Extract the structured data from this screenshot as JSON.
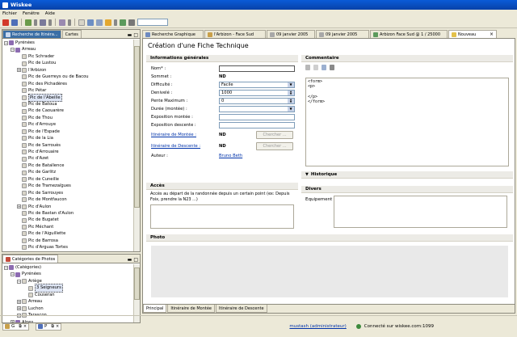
{
  "window": {
    "title": "Wiskee"
  },
  "menu": [
    {
      "label": "Fichier"
    },
    {
      "label": "Fenêtre"
    },
    {
      "label": "Aide"
    }
  ],
  "toolbar": {
    "search_value": ""
  },
  "left_top_tabs": [
    {
      "label": "Recherche de Itinéra..."
    },
    {
      "label": "Cartes"
    }
  ],
  "tree": [
    {
      "label": "Pyrénées",
      "level": 0,
      "exp": "-"
    },
    {
      "label": "Arreau",
      "level": 1,
      "exp": "-"
    },
    {
      "label": "Pic Schrader",
      "level": 2
    },
    {
      "label": "Pic de Lustou",
      "level": 2
    },
    {
      "label": "l'Arbizon",
      "level": 2,
      "exp": "+"
    },
    {
      "label": "Pic de Guerreys ou de Bacou",
      "level": 2
    },
    {
      "label": "Pic des Pichadères",
      "level": 2
    },
    {
      "label": "Pic Pétar",
      "level": 2
    },
    {
      "label": "Pic de l'Abeille",
      "level": 2,
      "selected": true
    },
    {
      "label": "Pic de Batoua",
      "level": 2
    },
    {
      "label": "Pic de Caouarère",
      "level": 2
    },
    {
      "label": "Pic de Thou",
      "level": 2
    },
    {
      "label": "Pic d'Arrouye",
      "level": 2
    },
    {
      "label": "Pic de l'Espade",
      "level": 2
    },
    {
      "label": "Pic de la Lia",
      "level": 2
    },
    {
      "label": "Pic de Sarrouès",
      "level": 2
    },
    {
      "label": "Pic d'Arrouaire",
      "level": 2
    },
    {
      "label": "Pic d'Azet",
      "level": 2
    },
    {
      "label": "Pic de Batallence",
      "level": 2
    },
    {
      "label": "Pic de Garlitz",
      "level": 2
    },
    {
      "label": "Pic de Cuneille",
      "level": 2
    },
    {
      "label": "Pic de Tramezaïgues",
      "level": 2
    },
    {
      "label": "Pic de Sarrouyes",
      "level": 2
    },
    {
      "label": "Pic de Montfaucon",
      "level": 2
    },
    {
      "label": "Pic d'Aulon",
      "level": 2,
      "exp": "+"
    },
    {
      "label": "Pic de Bastan d'Aulon",
      "level": 2
    },
    {
      "label": "Pic de Bugatet",
      "level": 2
    },
    {
      "label": "Pic Méchant",
      "level": 2
    },
    {
      "label": "Pic de l'Aiguillette",
      "level": 2
    },
    {
      "label": "Pic de Barrosa",
      "level": 2
    },
    {
      "label": "Pic d'Arguas Tortes",
      "level": 2
    }
  ],
  "photo_panel": {
    "title": "Catégories de Photos"
  },
  "photo_tree": [
    {
      "label": "(Catégories)",
      "level": 0,
      "exp": "-"
    },
    {
      "label": "Pyrénées",
      "level": 1,
      "exp": "-"
    },
    {
      "label": "Ariège",
      "level": 2,
      "exp": "-"
    },
    {
      "label": "3 Seigneurs",
      "level": 3,
      "selected": true
    },
    {
      "label": "Couseran",
      "level": 3
    },
    {
      "label": "Arreau",
      "level": 2,
      "exp": "+"
    },
    {
      "label": "Luchon",
      "level": 2,
      "exp": "+"
    },
    {
      "label": "Tarascon",
      "level": 2,
      "exp": "+"
    },
    {
      "label": "Alpes",
      "level": 1,
      "exp": "+"
    }
  ],
  "editor_tabs": [
    {
      "label": "Recherche Graphique"
    },
    {
      "label": "l'Arbizon - Face Sud"
    },
    {
      "label": "09 janvier 2005"
    },
    {
      "label": "09 janvier 2005"
    },
    {
      "label": "Arbizon Face Sud @ 1 / 25000"
    },
    {
      "label": "Nouveau",
      "active": true
    }
  ],
  "form": {
    "title": "Création d'une Fiche Technique",
    "general_header": "Informations générales",
    "nom_label": "Nom* :",
    "nom_value": "",
    "sommet_label": "Sommet :",
    "sommet_value": "ND",
    "difficulte_label": "Difficulté :",
    "difficulte_value": "Facile",
    "denivele_label": "Denivelé :",
    "denivele_value": "1000",
    "pente_label": "Pente Maximum :",
    "pente_value": "0",
    "duree_label": "Durée (montée) :",
    "duree_value": "",
    "expo_montee_label": "Exposition montée :",
    "expo_descente_label": "Exposition descente :",
    "iti_montee_label": "Itinéraire de Montée :",
    "iti_montee_value": "ND",
    "iti_descente_label": "Itinéraire de Descente :",
    "iti_descente_value": "ND",
    "chercher_label": "Chercher ...",
    "auteur_label": "Auteur :",
    "auteur_value": "Bruno Beth",
    "acces_header": "Accès",
    "acces_desc": "Accès au départ de la randonnée depuis un certain point (ex: Depuis Foix, prendre la N23 ...)",
    "commentaire_header": "Commentaire",
    "comment_text": "<form>\n<p>\n\n</p>\n</form>",
    "historique_header": "Historique",
    "divers_header": "Divers",
    "equipement_label": "Equipement",
    "photo_header": "Photo"
  },
  "bottom_tabs": [
    {
      "label": "Principal",
      "active": true
    },
    {
      "label": "Itinéraire de Montée"
    },
    {
      "label": "Itinéraire de Descente"
    }
  ],
  "status": {
    "mini_tab1": "G",
    "mini_tab2": "P",
    "user": "mustash (administrateur)",
    "connection": "Connecté sur wiskee.com:1099"
  },
  "colors": {
    "title_blue": "#0a5bd8",
    "selection": "#3a6ea5",
    "link": "#0033aa"
  }
}
